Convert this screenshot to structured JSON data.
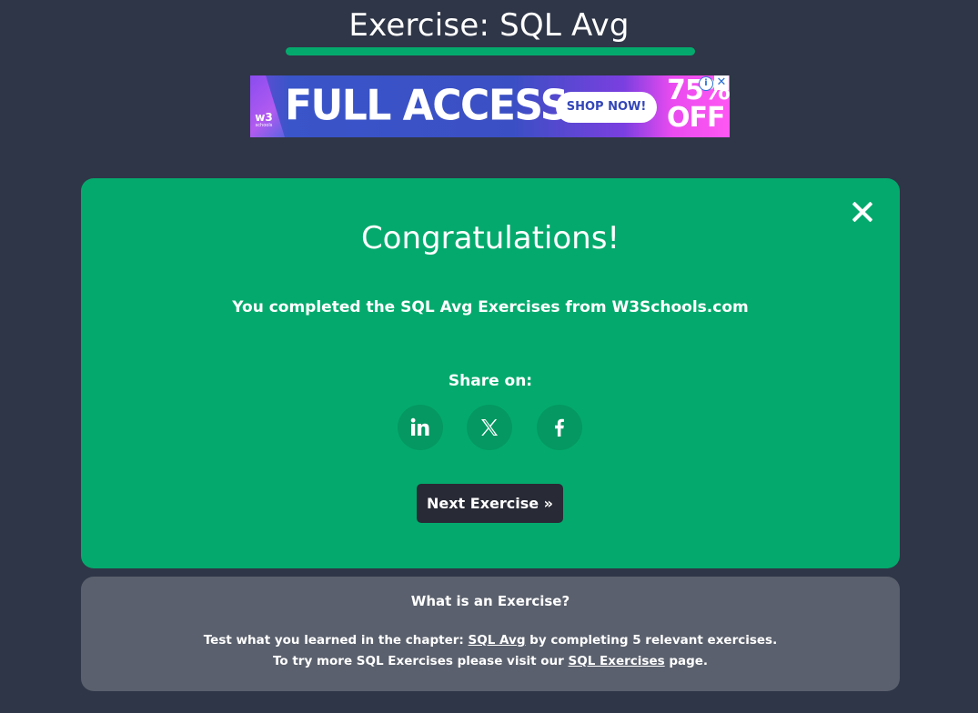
{
  "header": {
    "title": "Exercise: SQL Avg",
    "accent_color": "#04aa6d"
  },
  "ad": {
    "headline": "FULL ACCESS",
    "cta": "SHOP NOW!",
    "discount_value": "75%",
    "discount_word": "OFF",
    "logo_text": "w3",
    "logo_subtext": "schools",
    "info_icon": "info-icon",
    "close_icon": "close-icon"
  },
  "card": {
    "background_color": "#04aa6d",
    "heading": "Congratulations!",
    "message": "You completed the SQL Avg Exercises from W3Schools.com",
    "share_label": "Share on:",
    "share_icons": [
      "linkedin-icon",
      "x-icon",
      "facebook-icon"
    ],
    "next_button": "Next Exercise »",
    "close_icon": "close-icon"
  },
  "info": {
    "title": "What is an Exercise?",
    "line1_prefix": "Test what you learned in the chapter: ",
    "line1_link": "SQL Avg",
    "line1_suffix": " by completing 5 relevant exercises.",
    "line2_prefix": "To try more SQL Exercises please visit our ",
    "line2_link": "SQL Exercises",
    "line2_suffix": " page."
  }
}
